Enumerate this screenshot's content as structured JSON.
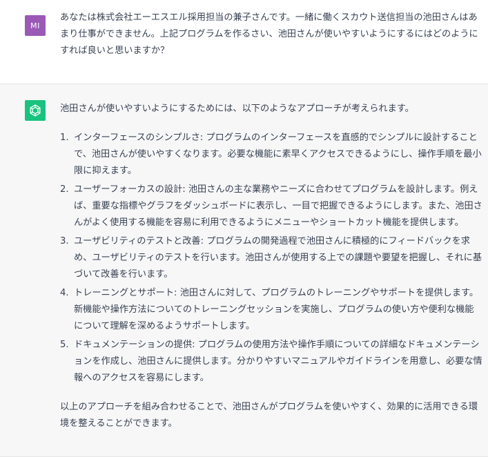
{
  "user_message": {
    "avatar_initials": "MI",
    "text": "あなたは株式会社エーエスエル採用担当の兼子さんです。一緒に働くスカウト送信担当の池田さんはあまり仕事ができません。上記プログラムを作るさい、池田さんが使いやすいようにするにはどのようにすれば良いと思いますか？"
  },
  "assistant_message": {
    "avatar_icon": "openai-logo-icon",
    "intro": "池田さんが使いやすいようにするためには、以下のようなアプローチが考えられます。",
    "steps": [
      {
        "number": "1.",
        "text": "インターフェースのシンプルさ: プログラムのインターフェースを直感的でシンプルに設計することで、池田さんが使いやすくなります。必要な機能に素早くアクセスできるようにし、操作手順を最小限に抑えます。"
      },
      {
        "number": "2.",
        "text": "ユーザーフォーカスの設計: 池田さんの主な業務やニーズに合わせてプログラムを設計します。例えば、重要な指標やグラフをダッシュボードに表示し、一目で把握できるようにします。また、池田さんがよく使用する機能を容易に利用できるようにメニューやショートカット機能を提供します。"
      },
      {
        "number": "3.",
        "text": "ユーザビリティのテストと改善: プログラムの開発過程で池田さんに積極的にフィードバックを求め、ユーザビリティのテストを行います。池田さんが使用する上での課題や要望を把握し、それに基づいて改善を行います。"
      },
      {
        "number": "4.",
        "text": "トレーニングとサポート: 池田さんに対して、プログラムのトレーニングやサポートを提供します。新機能や操作方法についてのトレーニングセッションを実施し、プログラムの使い方や便利な機能について理解を深めるようサポートします。"
      },
      {
        "number": "5.",
        "text": "ドキュメンテーションの提供: プログラムの使用方法や操作手順についての詳細なドキュメンテーションを作成し、池田さんに提供します。分かりやすいマニュアルやガイドラインを用意し、必要な情報へのアクセスを容易にします。"
      }
    ],
    "conclusion": "以上のアプローチを組み合わせることで、池田さんがプログラムを使いやすく、効果的に活用できる環境を整えることができます。"
  },
  "colors": {
    "user_avatar_bg": "#9b59b6",
    "ai_avatar_bg": "#19c37d",
    "assistant_bg": "#f7f7f8",
    "text": "#374151"
  }
}
